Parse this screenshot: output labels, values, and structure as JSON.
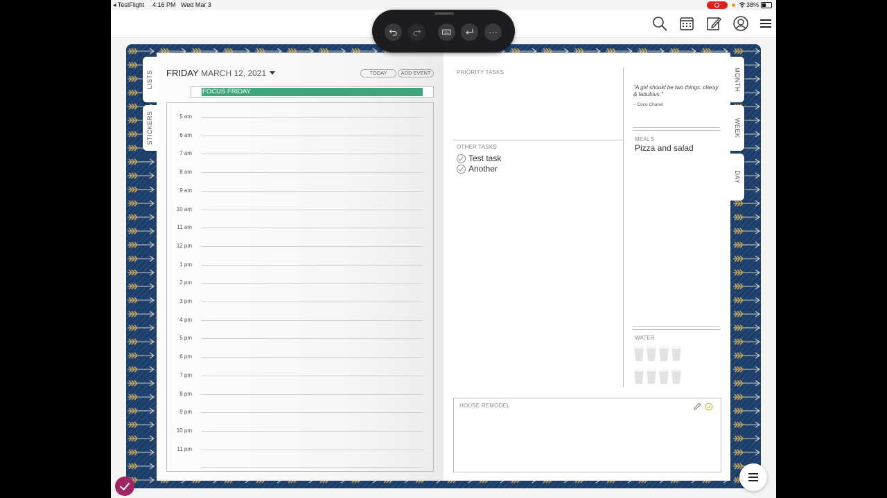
{
  "status_bar": {
    "back_app": "◂ TestFlight",
    "time": "4:16 PM",
    "date": "Wed Mar 3",
    "battery": "38%"
  },
  "toolbar": {
    "buttons": [
      {
        "name": "undo",
        "icon": "undo-icon"
      },
      {
        "name": "redo",
        "icon": "redo-icon"
      },
      {
        "name": "keyboard",
        "icon": "keyboard-icon"
      },
      {
        "name": "return",
        "icon": "return-icon"
      },
      {
        "name": "more",
        "icon": "more-icon",
        "label": "···"
      }
    ]
  },
  "topbar_icons": [
    "search-icon",
    "calendar-icon",
    "edit-icon",
    "account-icon",
    "menu-icon"
  ],
  "tabs": {
    "left": [
      "LISTS",
      "STICKERS"
    ],
    "right": [
      "MONTH",
      "WEEK",
      "DAY"
    ]
  },
  "day": {
    "weekday": "FRIDAY",
    "date": "MARCH 12, 2021",
    "today_button": "TODAY",
    "add_event_button": "ADD EVENT",
    "focus": "FOCUS FRIDAY",
    "hours": [
      "5 am",
      "6 am",
      "7 am",
      "8 am",
      "9 am",
      "10 am",
      "11 am",
      "12 pm",
      "1 pm",
      "2 pm",
      "3 pm",
      "4 pm",
      "5 pm",
      "6 pm",
      "7 pm",
      "8 pm",
      "9 pm",
      "10 pm",
      "11 pm"
    ]
  },
  "priority_tasks": {
    "label": "PRIORITY TASKS"
  },
  "other_tasks": {
    "label": "OTHER TASKS",
    "items": [
      "Test task",
      "Another"
    ]
  },
  "quote": {
    "text": "\"A girl should be two things: classy & fabulous.\"",
    "author": "– Coco Chanel"
  },
  "meals": {
    "label": "MEALS",
    "value": "Pizza and salad"
  },
  "water": {
    "label": "WATER",
    "glasses": 8
  },
  "notes": {
    "title": "HOUSE REMODEL"
  },
  "colors": {
    "cover": "#1e3f6e",
    "focus": "#3da67b",
    "fab": "#a02563"
  }
}
